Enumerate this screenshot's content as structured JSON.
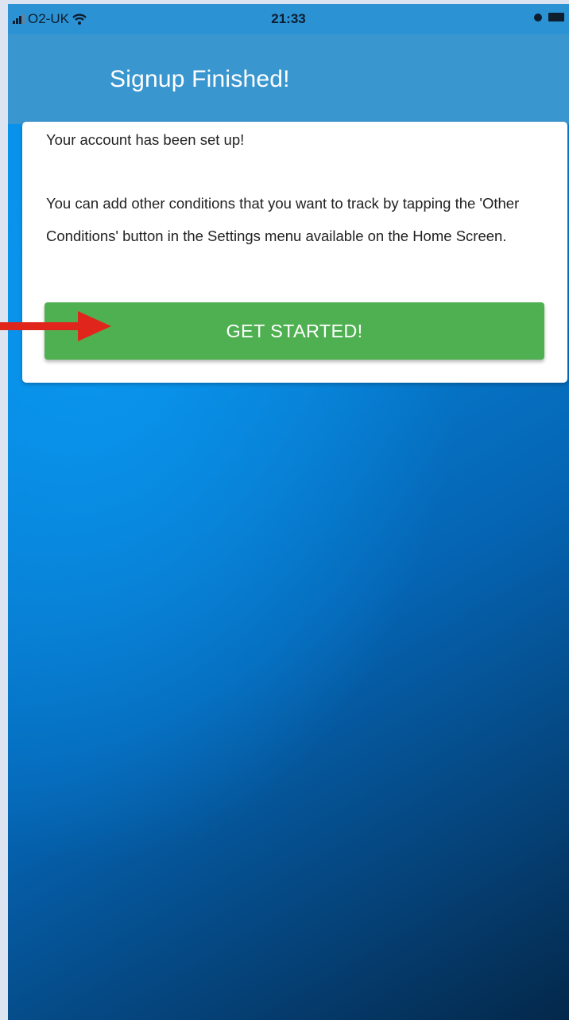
{
  "status_bar": {
    "carrier": "O2-UK",
    "time": "21:33"
  },
  "header": {
    "title": "Signup Finished!"
  },
  "card": {
    "line1": "Your account has been set up!",
    "paragraph": "You can add other conditions that you want to track by tapping the 'Other Conditions' button in the Settings menu available on the Home Screen.",
    "button_label": "GET STARTED!"
  },
  "colors": {
    "header": "#3a96cf",
    "button": "#4fb051",
    "arrow": "#e0261c",
    "background_top": "#0790eb",
    "background_bottom": "#04284a"
  },
  "icons": [
    "signal-icon",
    "wifi-icon",
    "alarm-icon",
    "battery-icon",
    "arrow-icon"
  ]
}
